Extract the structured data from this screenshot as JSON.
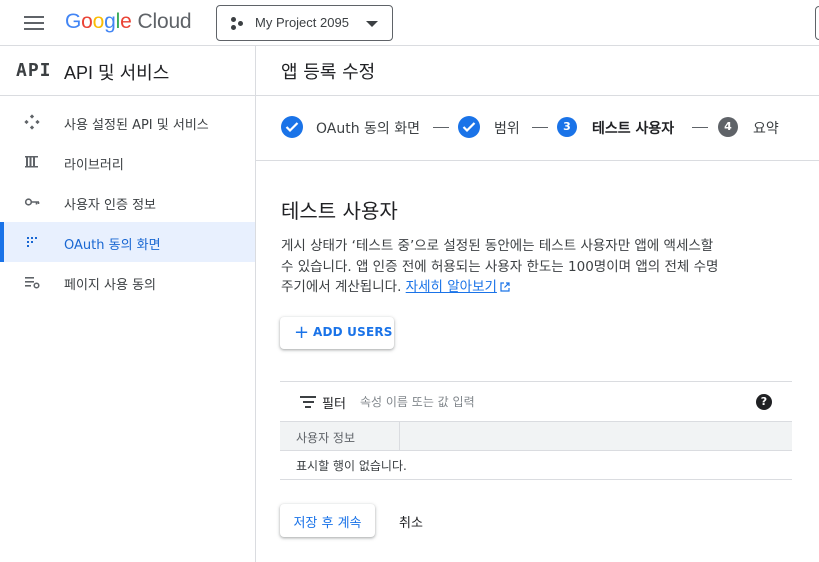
{
  "header": {
    "logo_letters": [
      "G",
      "o",
      "o",
      "g",
      "l",
      "e"
    ],
    "logo_cloud": "Cloud",
    "project_name": "My Project 2095"
  },
  "sidebar": {
    "api_logo": "API",
    "title": "API 및 서비스",
    "items": [
      {
        "label": "사용 설정된 API 및 서비스",
        "icon": "enabled-apis-icon",
        "active": false
      },
      {
        "label": "라이브러리",
        "icon": "library-icon",
        "active": false
      },
      {
        "label": "사용자 인증 정보",
        "icon": "key-icon",
        "active": false
      },
      {
        "label": "OAuth 동의 화면",
        "icon": "oauth-consent-icon",
        "active": true
      },
      {
        "label": "페이지 사용 동의",
        "icon": "page-usage-icon",
        "active": false
      }
    ]
  },
  "main": {
    "page_title": "앱 등록 수정",
    "steps": [
      {
        "label": "OAuth 동의 화면",
        "state": "done"
      },
      {
        "label": "범위",
        "state": "done"
      },
      {
        "number": "3",
        "label": "테스트 사용자",
        "state": "current"
      },
      {
        "number": "4",
        "label": "요약",
        "state": "pending"
      }
    ],
    "section_title": "테스트 사용자",
    "description_line1": "게시 상태가 ‘테스트 중’으로 설정된 동안에는 테스트 사용자만 앱에 액세스할",
    "description_line2": "수 있습니다. 앱 인증 전에 허용되는 사용자 한도는 100명이며 앱의 전체 수명",
    "description_line3": "주기에서 계산됩니다.",
    "learn_more": "자세히 알아보기",
    "add_users_label": "ADD USERS",
    "filter": {
      "label": "필터",
      "placeholder": "속성 이름 또는 값 입력"
    },
    "table": {
      "column_header": "사용자 정보",
      "empty_text": "표시할 행이 없습니다."
    },
    "save_label": "저장 후 계속",
    "cancel_label": "취소"
  },
  "colors": {
    "accent": "#1a73e8",
    "active_bg": "#e8f0fe",
    "step_pending": "#5f6368"
  }
}
